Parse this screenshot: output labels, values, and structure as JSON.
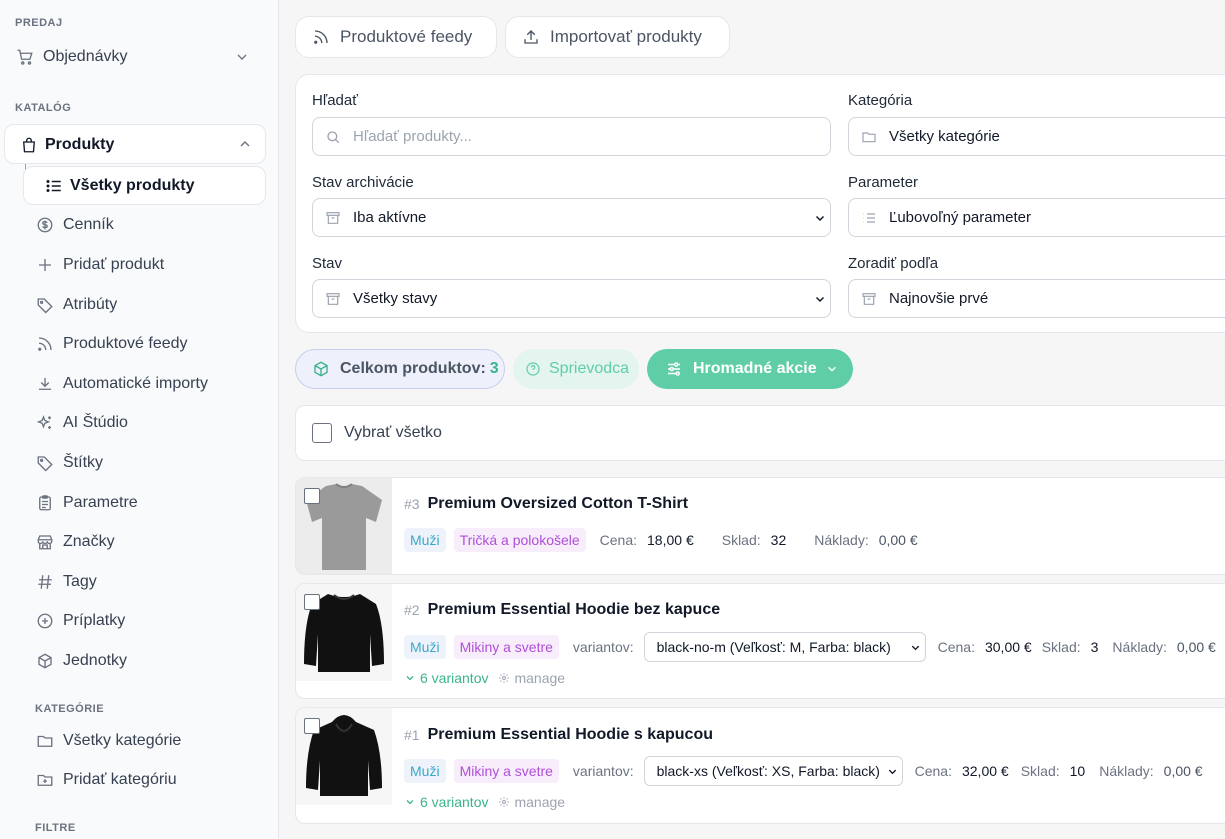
{
  "sidebar": {
    "sections": {
      "sales": "PREDAJ",
      "catalog": "KATALÓG",
      "categories": "KATEGÓRIE",
      "filters": "FILTRE"
    },
    "orders": "Objednávky",
    "products": "Produkty",
    "all_products": "Všetky produkty",
    "catalog_items": [
      "Cenník",
      "Pridať produkt",
      "Atribúty",
      "Produktové feedy",
      "Automatické importy",
      "AI Štúdio",
      "Štítky",
      "Parametre",
      "Značky",
      "Tagy",
      "Príplatky",
      "Jednotky"
    ],
    "category_items": [
      "Všetky kategórie",
      "Pridať kategóriu"
    ]
  },
  "toolbar": {
    "feeds": "Produktové feedy",
    "import": "Importovať produkty"
  },
  "filters": {
    "search_label": "Hľadať",
    "search_placeholder": "Hľadať produkty...",
    "category_label": "Kategória",
    "category_value": "Všetky kategórie",
    "archive_label": "Stav archivácie",
    "archive_value": "Iba aktívne",
    "parameter_label": "Parameter",
    "parameter_value": "Ľubovoľný parameter",
    "status_label": "Stav",
    "status_value": "Všetky stavy",
    "sort_label": "Zoradiť podľa",
    "sort_value": "Najnovšie prvé"
  },
  "summary": {
    "total_label": "Celkom produktov:",
    "total_count": "3",
    "guide": "Sprievodca",
    "bulk": "Hromadné akcie"
  },
  "select_all": "Vybrať všetko",
  "labels": {
    "price": "Cena:",
    "stock": "Sklad:",
    "costs": "Náklady:",
    "variants": "variantov:",
    "manage": "manage"
  },
  "products": [
    {
      "num": "#3",
      "name": "Premium Oversized Cotton T-Shirt",
      "gender": "Muži",
      "category": "Tričká a polokošele",
      "price": "18,00 €",
      "stock": "32",
      "costs": "0,00 €"
    },
    {
      "num": "#2",
      "name": "Premium Essential Hoodie bez kapuce",
      "gender": "Muži",
      "category": "Mikiny a svetre",
      "variant": "black-no-m (Veľkosť: M, Farba: black)",
      "price": "30,00 €",
      "stock": "3",
      "costs": "0,00 €",
      "variant_count": "6 variantov"
    },
    {
      "num": "#1",
      "name": "Premium Essential Hoodie s kapucou",
      "gender": "Muži",
      "category": "Mikiny a svetre",
      "variant": "black-xs (Veľkosť: XS, Farba: black)",
      "price": "32,00 €",
      "stock": "10",
      "costs": "0,00 €",
      "variant_count": "6 variantov"
    }
  ],
  "colors": {
    "accent": "#5fcea7",
    "accent_dark": "#3bb38c",
    "total_bg": "#eef0fb",
    "tag_gender": "#3ba7c9",
    "tag_category": "#b14fd8"
  }
}
